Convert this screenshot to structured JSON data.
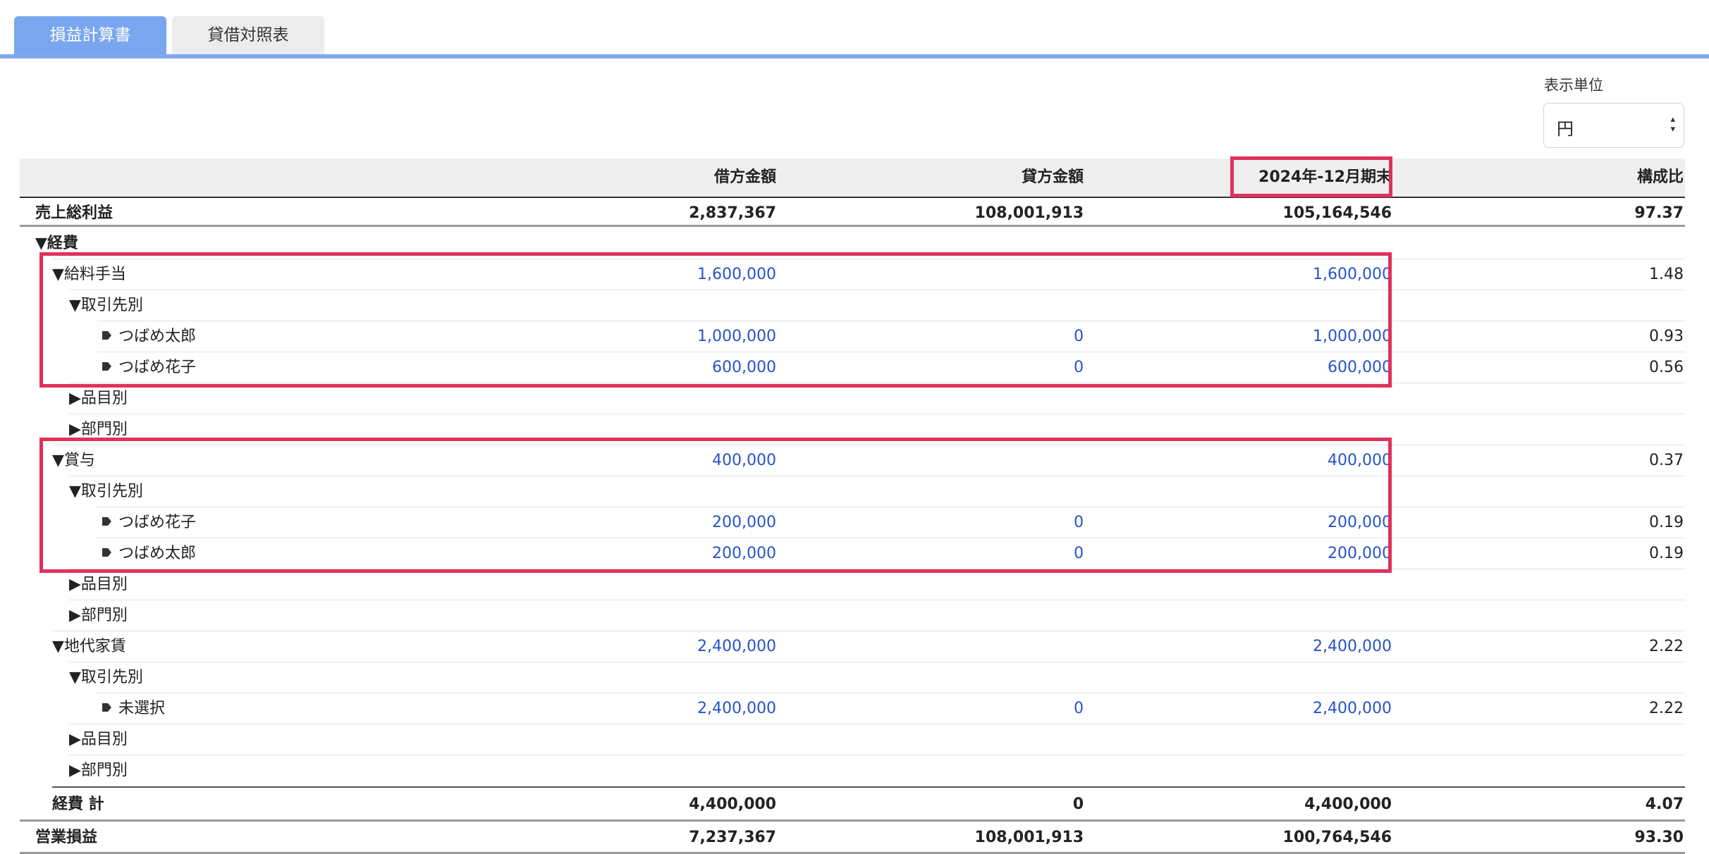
{
  "tabs": [
    {
      "label": "損益計算書",
      "active": true
    },
    {
      "label": "貸借対照表",
      "active": false
    }
  ],
  "unit": {
    "label": "表示単位",
    "selected": "円"
  },
  "table": {
    "headers": [
      "",
      "借方金額",
      "貸方金額",
      "2024年-12月期末",
      "構成比"
    ],
    "rows": [
      {
        "label": "売上総利益",
        "debit": "2,837,367",
        "credit": "108,001,913",
        "balance": "105,164,546",
        "ratio": "97.37"
      },
      {
        "label": "▼経費",
        "debit": "",
        "credit": "",
        "balance": "",
        "ratio": ""
      },
      {
        "label": "▼給料手当",
        "debit": "1,600,000",
        "credit": "",
        "balance": "1,600,000",
        "ratio": "1.48"
      },
      {
        "label": "▼取引先別",
        "debit": "",
        "credit": "",
        "balance": "",
        "ratio": ""
      },
      {
        "label": "つばめ太郎",
        "debit": "1,000,000",
        "credit": "0",
        "balance": "1,000,000",
        "ratio": "0.93"
      },
      {
        "label": "つばめ花子",
        "debit": "600,000",
        "credit": "0",
        "balance": "600,000",
        "ratio": "0.56"
      },
      {
        "label": "▶品目別",
        "debit": "",
        "credit": "",
        "balance": "",
        "ratio": ""
      },
      {
        "label": "▶部門別",
        "debit": "",
        "credit": "",
        "balance": "",
        "ratio": ""
      },
      {
        "label": "▼賞与",
        "debit": "400,000",
        "credit": "",
        "balance": "400,000",
        "ratio": "0.37"
      },
      {
        "label": "▼取引先別",
        "debit": "",
        "credit": "",
        "balance": "",
        "ratio": ""
      },
      {
        "label": "つばめ花子",
        "debit": "200,000",
        "credit": "0",
        "balance": "200,000",
        "ratio": "0.19"
      },
      {
        "label": "つばめ太郎",
        "debit": "200,000",
        "credit": "0",
        "balance": "200,000",
        "ratio": "0.19"
      },
      {
        "label": "▶品目別",
        "debit": "",
        "credit": "",
        "balance": "",
        "ratio": ""
      },
      {
        "label": "▶部門別",
        "debit": "",
        "credit": "",
        "balance": "",
        "ratio": ""
      },
      {
        "label": "▼地代家賃",
        "debit": "2,400,000",
        "credit": "",
        "balance": "2,400,000",
        "ratio": "2.22"
      },
      {
        "label": "▼取引先別",
        "debit": "",
        "credit": "",
        "balance": "",
        "ratio": ""
      },
      {
        "label": "未選択",
        "debit": "2,400,000",
        "credit": "0",
        "balance": "2,400,000",
        "ratio": "2.22"
      },
      {
        "label": "▶品目別",
        "debit": "",
        "credit": "",
        "balance": "",
        "ratio": ""
      },
      {
        "label": "▶部門別",
        "debit": "",
        "credit": "",
        "balance": "",
        "ratio": ""
      },
      {
        "label": "経費 計",
        "debit": "4,400,000",
        "credit": "0",
        "balance": "4,400,000",
        "ratio": "4.07"
      },
      {
        "label": "営業損益",
        "debit": "7,237,367",
        "credit": "108,001,913",
        "balance": "100,764,546",
        "ratio": "93.30"
      }
    ]
  },
  "icons": {
    "tag": "tag-icon",
    "select_arrow": "updown-arrow-icon"
  },
  "colors": {
    "tab_active": "#79a6ee",
    "link_blue": "#2653c8",
    "highlight": "#e0315a"
  }
}
